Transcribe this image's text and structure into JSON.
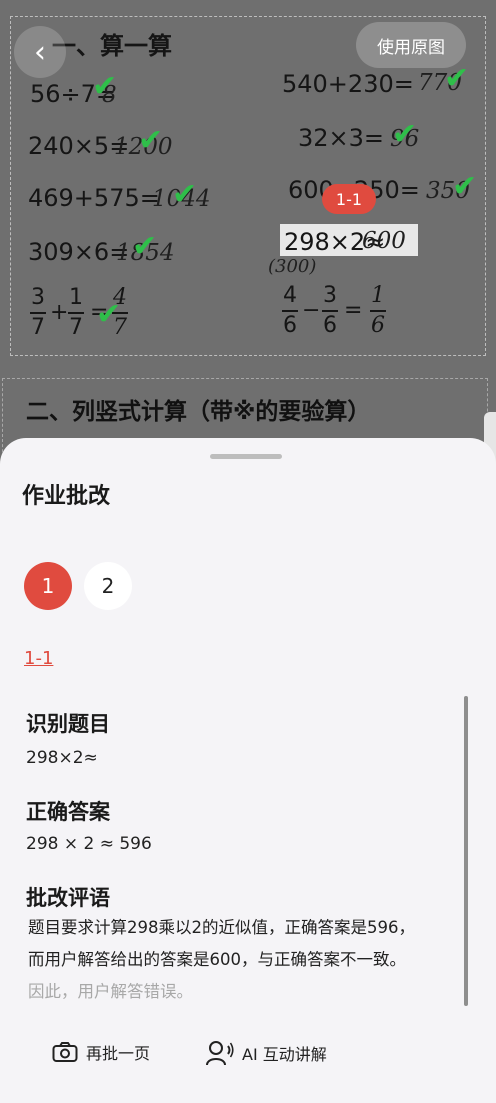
{
  "photo": {
    "back_icon": "back-arrow-icon",
    "use_original_label": "使用原图",
    "section1_title": "一、算一算",
    "left_problems": [
      {
        "problem": "56÷7=",
        "answer": "8"
      },
      {
        "problem": "240×5=",
        "answer": "1200"
      },
      {
        "problem": "469+575=",
        "answer": "1044"
      },
      {
        "problem": "309×6=",
        "answer": "1854"
      }
    ],
    "right_problems": [
      {
        "problem": "540+230=",
        "answer": "770"
      },
      {
        "problem": "32×3=",
        "answer": "96"
      },
      {
        "problem": "600−250=",
        "answer": "350"
      },
      {
        "problem": "298×2≈",
        "answer": "600"
      }
    ],
    "left_fraction": {
      "a_num": "3",
      "a_den": "7",
      "op": "+",
      "b_num": "1",
      "b_den": "7",
      "eq": "=",
      "ans_num": "4",
      "ans_den": "7"
    },
    "right_fraction": {
      "a_num": "4",
      "a_den": "6",
      "op": "−",
      "b_num": "3",
      "b_den": "6",
      "eq": "=",
      "ans_num": "1",
      "ans_den": "6"
    },
    "scratch_note": "(300)",
    "question_tag": "1-1",
    "section2_title": "二、列竖式计算（带※的要验算）",
    "check_icon": "check-mark-icon"
  },
  "sheet": {
    "title": "作业批改",
    "pages": [
      "1",
      "2"
    ],
    "active_page": "1",
    "question_link": "1-1",
    "recognized_heading": "识别题目",
    "recognized_value": "298×2≈",
    "correct_heading": "正确答案",
    "correct_value": "298 × 2 ≈ 596",
    "comment_heading": "批改评语",
    "comment_line1": "题目要求计算298乘以2的近似值，正确答案是596，",
    "comment_line2": "而用户解答给出的答案是600，与正确答案不一致。",
    "comment_line3": "因此，用户解答错误。",
    "footer": {
      "rescan_label": "再批一页",
      "rescan_icon": "camera-icon",
      "ai_label": "AI 互动讲解",
      "ai_icon": "voice-assistant-icon"
    },
    "accent_color": "#e04b3f",
    "check_color": "#2fbf4a"
  }
}
